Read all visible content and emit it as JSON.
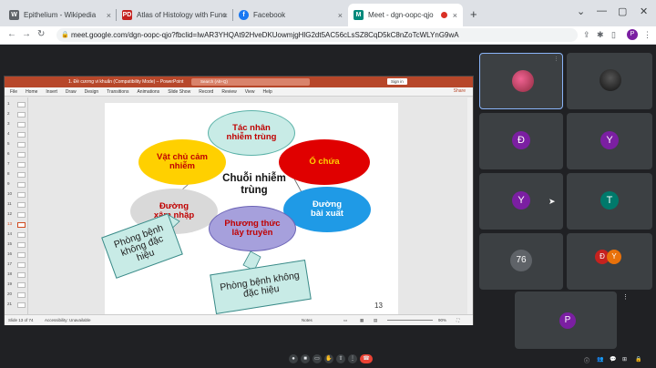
{
  "browser": {
    "tabs": [
      {
        "title": "Epithelium - Wikipedia",
        "icon": "wikipedia-icon",
        "icon_letter": "W",
        "icon_color": "#5f6368"
      },
      {
        "title": "Atlas of Histology with Function...",
        "icon": "pdf-icon",
        "icon_letter": "PD",
        "icon_color": "#c5221f"
      },
      {
        "title": "Facebook",
        "icon": "facebook-icon",
        "icon_letter": "f",
        "icon_color": "#1877f2"
      },
      {
        "title": "Meet - dgn-oopc-qjo",
        "icon": "meet-icon",
        "icon_letter": "M",
        "icon_color": "#00897b",
        "active": true
      }
    ],
    "url": "meet.google.com/dgn-oopc-qjo?fbclid=IwAR3YHQAt92HveDKUowmjgHlG2dt5AC56cLsSZ8CqD5kC8nZoTcWLYnG9wA",
    "profile_letter": "P"
  },
  "powerpoint": {
    "window_title": "1. Đề cương vi khuẩn (Compatibility Mode) – PowerPoint",
    "search_placeholder": "Search (Alt+Q)",
    "sign_in": "Sign in",
    "share": "Share",
    "menu": [
      "File",
      "Home",
      "Insert",
      "Draw",
      "Design",
      "Transitions",
      "Animations",
      "Slide Show",
      "Record",
      "Review",
      "View",
      "Help"
    ],
    "thumb_numbers": [
      "1",
      "2",
      "3",
      "4",
      "5",
      "6",
      "7",
      "8",
      "9",
      "10",
      "11",
      "12",
      "13",
      "14",
      "15",
      "16",
      "17",
      "18",
      "19",
      "20",
      "21"
    ],
    "selected_thumb": "13",
    "status": {
      "slide": "Slide 13 of 74",
      "accessibility": "Accessibility: Unavailable",
      "notes": "Notes",
      "zoom": "90%"
    }
  },
  "slide": {
    "center": "Chuỗi nhiễm trùng",
    "bubbles": {
      "tac_nhan": "Tác nhân nhiễm trùng",
      "vat_chu": "Vật chủ cảm nhiễm",
      "o_chua": "Ổ chứa",
      "duong_xam_nhap": "Đường xâm nhập",
      "duong_bai_xuat": "Đường bài xuất",
      "phuong_thuc": "Phương thức lây truyền"
    },
    "callout_left": "Phòng bệnh không đặc hiệu",
    "callout_right": "Phòng bệnh không đặc hiệu",
    "number": "13",
    "colors": {
      "tac_nhan": "#c8ebe6",
      "vat_chu": "#ffd000",
      "o_chua": "#e00000",
      "duong_xam_nhap": "#d9d9d9",
      "duong_bai_xuat": "#1f9ae6",
      "phuong_thuc": "#a6a0dc"
    }
  },
  "participants": [
    {
      "letter": "",
      "photo": true
    },
    {
      "letter": "",
      "photo": true
    },
    {
      "letter": "Đ",
      "color": "#7b1fa2"
    },
    {
      "letter": "Y",
      "color": "#7b1fa2"
    },
    {
      "letter": "Y",
      "color": "#7b1fa2"
    },
    {
      "letter": "T",
      "color": "#00796b"
    },
    {
      "letter": "76",
      "color": "#5f6368"
    },
    {
      "letter": "Đ",
      "color": "#c5221f"
    },
    {
      "letter": "P",
      "color": "#7b1fa2"
    }
  ],
  "pair_second": "Y"
}
